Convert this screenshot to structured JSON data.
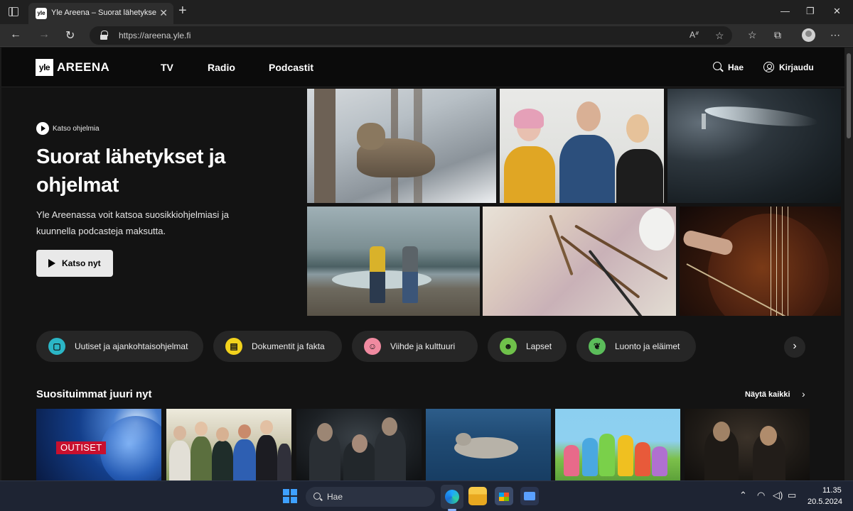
{
  "browser": {
    "tab_title": "Yle Areena – Suorat lähetykset ja",
    "tab_favicon_text": "yle",
    "url": "https://areena.yle.fi",
    "icons": [
      "sidebar-icon",
      "back-icon",
      "forward-icon",
      "refresh-icon",
      "lock-icon",
      "read-aloud-icon",
      "favorite-star-icon",
      "favorites-icon",
      "collections-icon",
      "profile-icon",
      "more-icon"
    ]
  },
  "site": {
    "logo_box": "yle",
    "logo_word": "AREENA",
    "nav": [
      "TV",
      "Radio",
      "Podcastit"
    ],
    "search_label": "Hae",
    "login_label": "Kirjaudu"
  },
  "hero": {
    "eyebrow": "Katso ohjelmia",
    "title": "Suorat lähetykset ja ohjelmat",
    "description": "Yle Areenassa voit katsoa suosikkiohjelmiasi ja kuunnella podcasteja maksutta.",
    "cta_label": "Katso nyt"
  },
  "categories": [
    {
      "label": "Uutiset ja ajankohtaisohjelmat",
      "color": "#2bb6c6",
      "icon": "news-icon"
    },
    {
      "label": "Dokumentit ja fakta",
      "color": "#f2d21c",
      "icon": "document-icon"
    },
    {
      "label": "Viihde ja kulttuuri",
      "color": "#f08aa0",
      "icon": "masks-icon"
    },
    {
      "label": "Lapset",
      "color": "#6fc14a",
      "icon": "kids-icon"
    },
    {
      "label": "Luonto ja eläimet",
      "color": "#5bbd5a",
      "icon": "leaf-icon"
    }
  ],
  "section": {
    "title": "Suosituimmat juuri nyt",
    "show_all": "Näytä kaikki",
    "news_badge": "OUTISET"
  },
  "taskbar": {
    "search_placeholder": "Hae",
    "time": "11.35",
    "date": "20.5.2024",
    "accent": "#3ea0ff"
  }
}
